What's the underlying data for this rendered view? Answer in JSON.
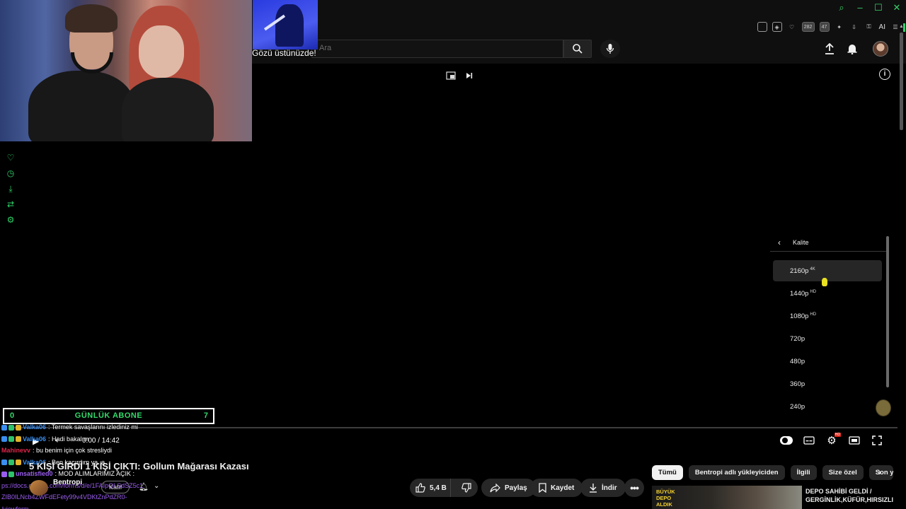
{
  "search": {
    "placeholder": "Ara"
  },
  "extensions": {
    "badge1": "282",
    "badge2": "47",
    "ai_label": "AI"
  },
  "overlay": {
    "caption": "Gözü üstünüzde!"
  },
  "quality_menu": {
    "title": "Kalite",
    "items": [
      {
        "label": "2160p",
        "badge": "4K"
      },
      {
        "label": "1440p",
        "badge": "HD"
      },
      {
        "label": "1080p",
        "badge": "HD"
      },
      {
        "label": "720p",
        "badge": ""
      },
      {
        "label": "480p",
        "badge": ""
      },
      {
        "label": "360p",
        "badge": ""
      },
      {
        "label": "240p",
        "badge": ""
      }
    ]
  },
  "player": {
    "time": "0:00 / 14:42",
    "progress": 0
  },
  "subs_counter": {
    "left": "0",
    "label": "GÜNLÜK ABONE",
    "right": "7"
  },
  "chat": [
    {
      "user": "Valka06",
      "user_color": "#3a8ef0",
      "message": ": Termek savaşlarını izlediniz mi"
    },
    {
      "user": "Valka06",
      "user_color": "#3a8ef0",
      "message": ": Hadi bakalım"
    },
    {
      "user": "Mahinevv",
      "user_color": "#e0264a",
      "message": ": bu benim için çok stresliydi"
    },
    {
      "user": "Valka06",
      "user_color": "#3a8ef0",
      "message": ": Ben kaçırdım ya. a"
    },
    {
      "user": "unsatisfied0",
      "user_color": "#9a5cf0",
      "message": ": MOD ALIMLARIMIZ AÇIK :"
    },
    {
      "user": "",
      "user_color": "#9a5cf0",
      "message": "ps://docs.google.com/forms/d/e/1FAIpQLSdSZ5c1"
    },
    {
      "user": "",
      "user_color": "#9a5cf0",
      "message": "ZIB0ILNcb4ZWFdEFety99v4VDKtZnPdZR0-"
    },
    {
      "user": "",
      "user_color": "#9a5cf0",
      "message": "/viewform"
    }
  ],
  "video": {
    "title": "5 KİŞİ GİRDİ 1 KİŞİ ÇIKTI: Gollum Mağarası Kazası",
    "channel": "Bentropi",
    "join": "Katıl",
    "likes": "5,4 B",
    "share": "Paylaş",
    "save": "Kaydet",
    "download": "İndir"
  },
  "chips": [
    "Tümü",
    "Bentropi adlı yükleyiciden",
    "İlgili",
    "Size özel",
    "Son y"
  ],
  "related": {
    "thumb_text": "BÜYÜK DEPO ALDIK",
    "title": "DEPO SAHİBİ GELDİ / GERGİNLİK,KÜFÜR,HIRSIZLI"
  },
  "colors": {
    "accent_green": "#34d96b",
    "youtube_red": "#e0261a"
  }
}
